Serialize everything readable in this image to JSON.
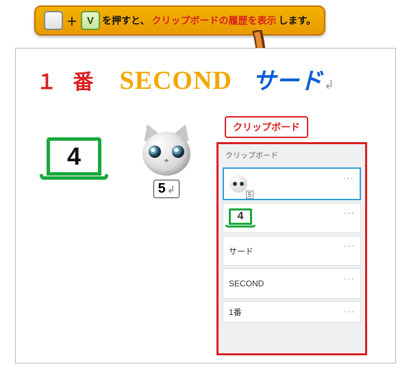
{
  "callout": {
    "prefix": " を押すと、",
    "highlight": "クリップボードの履歴を表示",
    "suffix": "します。",
    "key_plus": "＋",
    "key_v": "V"
  },
  "doc": {
    "word1": "１ 番",
    "word2": "SECOND",
    "word3": "サード",
    "return_mark": "↲",
    "laptop_digit": "4",
    "cat_digit": "5"
  },
  "clipboard": {
    "badge": "クリップボード",
    "title": "クリップボード",
    "more": "···",
    "items": [
      {
        "type": "cat-thumb",
        "sub": "5"
      },
      {
        "type": "laptop-thumb",
        "text": "4"
      },
      {
        "type": "text",
        "text": "サード"
      },
      {
        "type": "text",
        "text": "SECOND"
      },
      {
        "type": "text",
        "text": "1番"
      }
    ]
  }
}
